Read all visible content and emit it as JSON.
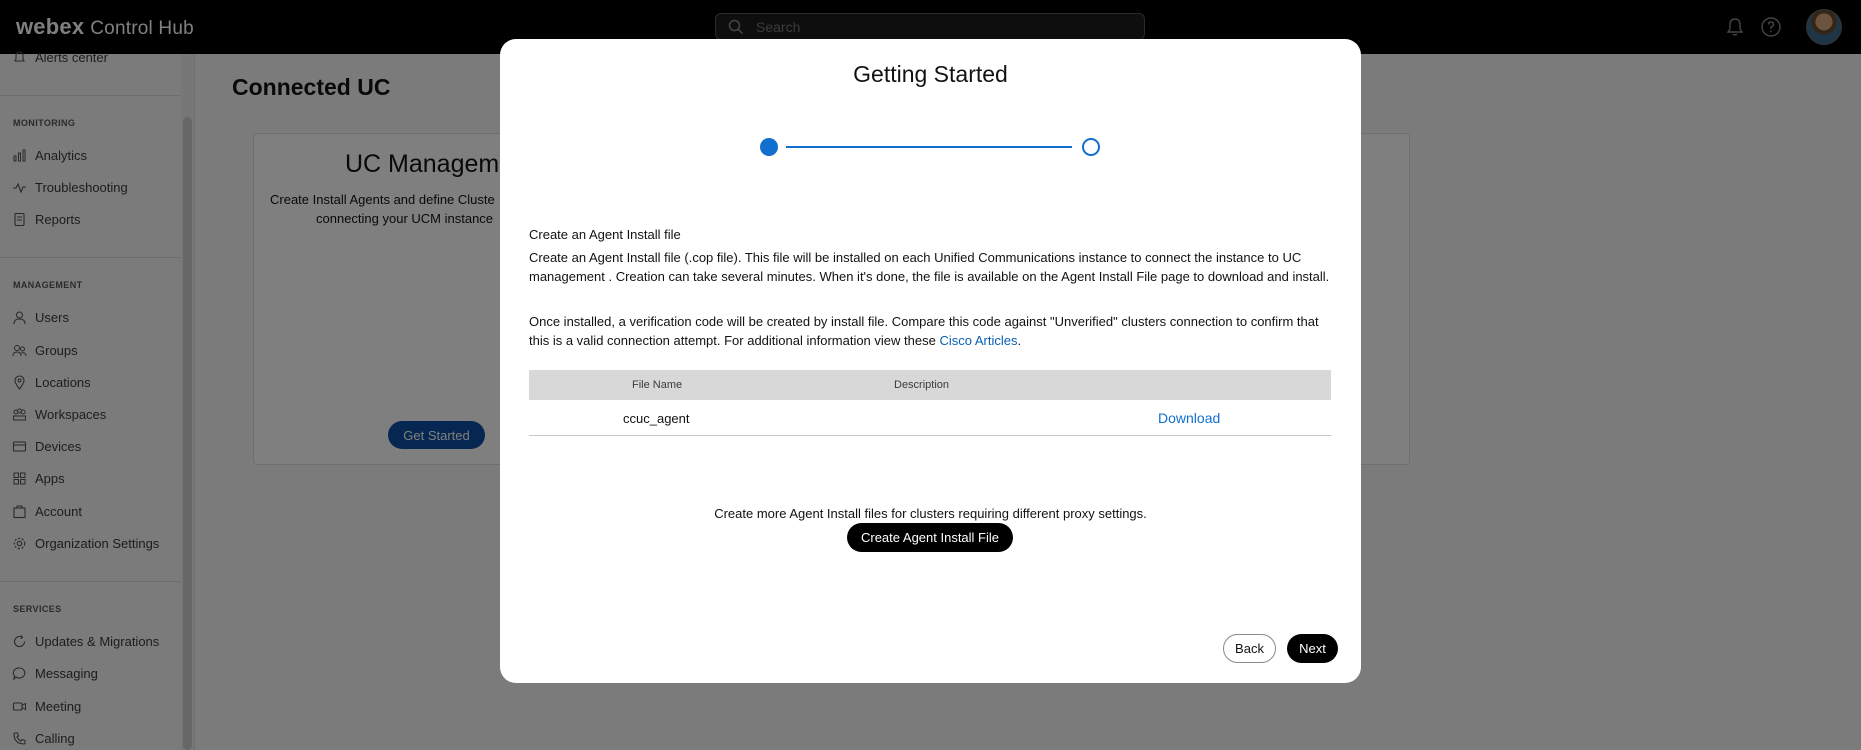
{
  "app": {
    "brand": "webex",
    "product": "Control Hub"
  },
  "search": {
    "placeholder": "Search"
  },
  "sidebar": {
    "top_item": "Alerts center",
    "sections": [
      {
        "label": "MONITORING",
        "items": [
          "Analytics",
          "Troubleshooting",
          "Reports"
        ]
      },
      {
        "label": "MANAGEMENT",
        "items": [
          "Users",
          "Groups",
          "Locations",
          "Workspaces",
          "Devices",
          "Apps",
          "Account",
          "Organization Settings"
        ]
      },
      {
        "label": "SERVICES",
        "items": [
          "Updates & Migrations",
          "Messaging",
          "Meeting",
          "Calling"
        ]
      }
    ]
  },
  "main": {
    "title": "Connected UC",
    "card": {
      "heading": "UC Manageme",
      "desc_line1": "Create Install Agents and define Cluste",
      "desc_line2": "connecting your UCM instance",
      "button": "Get Started"
    }
  },
  "modal": {
    "title": "Getting Started",
    "steps": {
      "total": 2,
      "current": 1
    },
    "section_heading": "Create an Agent Install file",
    "paragraph1": "Create an Agent Install file (.cop file). This file will be installed on each Unified Communications instance to connect the instance to UC management . Creation can take several minutes. When it's done, the file is available on the Agent Install File page to download and install.",
    "paragraph2": "Once installed, a verification code will be created by install file. Compare this code against \"Unverified\" clusters connection to confirm that this is a valid connection attempt. For additional information view these",
    "link": "Cisco Articles",
    "table": {
      "columns": [
        "File Name",
        "Description"
      ],
      "rows": [
        {
          "file_name": "ccuc_agent",
          "description": "",
          "action": "Download"
        }
      ]
    },
    "more_text": "Create more Agent Install files for clusters requiring different proxy settings.",
    "create_button": "Create Agent Install File",
    "back_button": "Back",
    "next_button": "Next"
  },
  "colors": {
    "accent": "#1170cf",
    "link": "#0a5fb4",
    "primary_button": "#000000",
    "topbar": "#000000"
  }
}
